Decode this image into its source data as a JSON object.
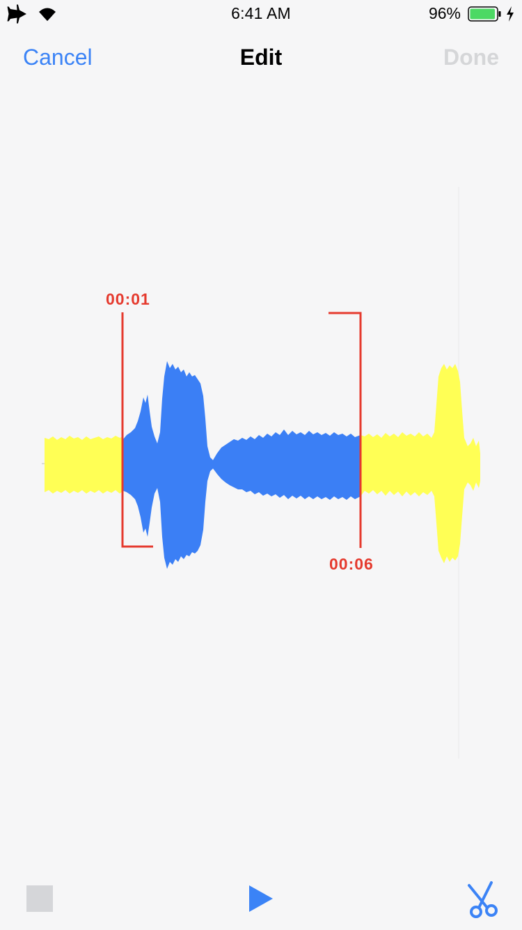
{
  "status_bar": {
    "time": "6:41 AM",
    "battery_percent": "96%",
    "battery_level": 0.96,
    "icons": [
      "airplane-icon",
      "wifi-icon",
      "battery-icon",
      "charging-icon"
    ]
  },
  "nav": {
    "cancel_label": "Cancel",
    "title": "Edit",
    "done_label": "Done"
  },
  "editor": {
    "selection_start": "00:01",
    "selection_end": "00:06"
  },
  "toolbar": {
    "icons": [
      "stop-icon",
      "play-icon",
      "scissors-icon"
    ]
  },
  "colors": {
    "accent": "#3b83f6",
    "selection": "#e53a2e",
    "unselected_wave": "#ffff55",
    "selected_wave": "#3b7ff5",
    "disabled": "#d5d6d8"
  }
}
